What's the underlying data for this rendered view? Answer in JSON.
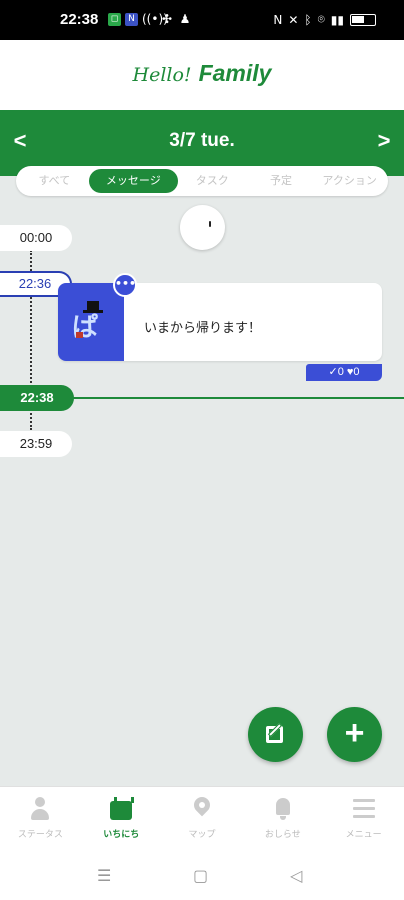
{
  "status_bar": {
    "time": "22:38",
    "left_icons": [
      "app-green-icon",
      "app-blue-icon",
      "wireless-icon",
      "fan-icon",
      "person-icon"
    ],
    "right_icons": [
      "nfc-icon",
      "mute-icon",
      "bluetooth-icon",
      "location-icon",
      "signal-icon",
      "battery-icon"
    ]
  },
  "header": {
    "logo_hello": "Hello!",
    "logo_family": "Family"
  },
  "date_nav": {
    "title": "3/7 tue.",
    "prev": "<",
    "next": ">"
  },
  "tabs": [
    {
      "label": "すべて",
      "active": false
    },
    {
      "label": "メッセージ",
      "active": true
    },
    {
      "label": "タスク",
      "active": false
    },
    {
      "label": "予定",
      "active": false
    },
    {
      "label": "アクション",
      "active": false
    }
  ],
  "timeline": {
    "start": "00:00",
    "message_time": "22:36",
    "now": "22:38",
    "end": "23:59"
  },
  "message": {
    "text": "いまから帰ります！",
    "bubble": "•••",
    "avatar_text": "ぱ",
    "reactions": {
      "check": "0",
      "heart": "0"
    }
  },
  "colors": {
    "brand_green": "#1e8a3a",
    "accent_blue": "#3b4ed6"
  },
  "bottom_nav": [
    {
      "label": "ステータス",
      "icon": "person-icon",
      "active": false
    },
    {
      "label": "いちにち",
      "icon": "calendar-icon",
      "active": true
    },
    {
      "label": "マップ",
      "icon": "map-pin-icon",
      "active": false
    },
    {
      "label": "おしらせ",
      "icon": "bell-icon",
      "active": false
    },
    {
      "label": "メニュー",
      "icon": "menu-icon",
      "active": false
    }
  ],
  "system_nav": {
    "recent": "☰",
    "home": "▢",
    "back": "◁"
  }
}
